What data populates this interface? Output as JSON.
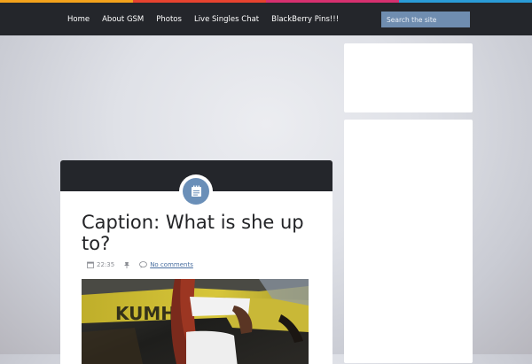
{
  "colors": {
    "stripe": [
      "#f3a21b",
      "#e7432f",
      "#d6306f",
      "#2a9bd7"
    ],
    "navbar": "#24262b",
    "search_bg": "#6f8db0",
    "accent": "#6a8fb8"
  },
  "nav": {
    "items": [
      "Home",
      "About GSM",
      "Photos",
      "Live Singles Chat",
      "BlackBerry Pins!!!"
    ]
  },
  "search": {
    "placeholder": "Search the site"
  },
  "post": {
    "icon": "notepad-icon",
    "title": "Caption: What is she up to?",
    "time": "22:35",
    "comments": "No comments",
    "image_text": "KUMH"
  }
}
